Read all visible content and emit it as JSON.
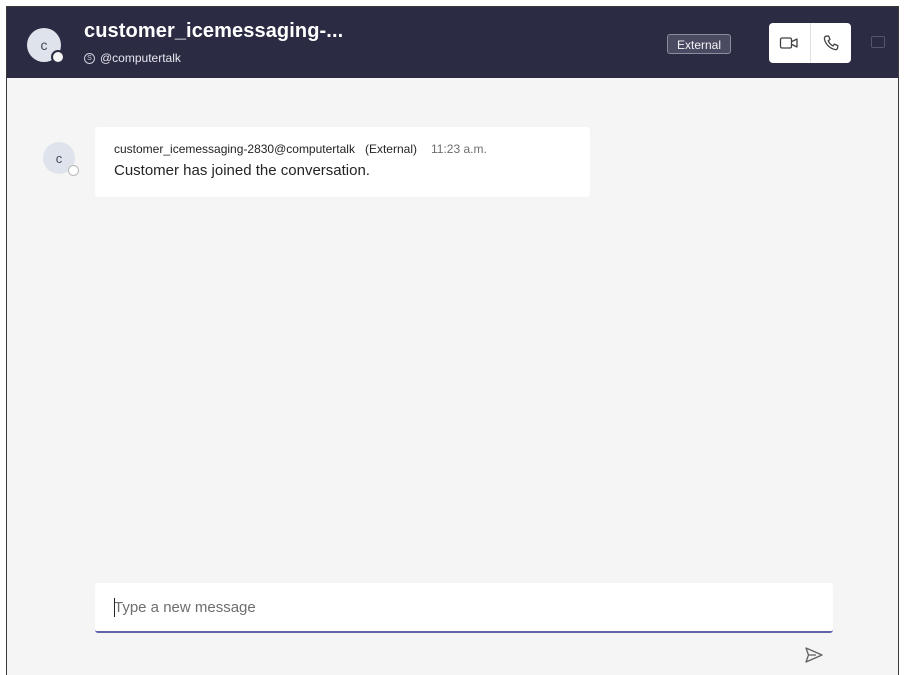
{
  "header": {
    "avatar_initial": "c",
    "title": "customer_icemessaging-...",
    "subtitle": "@computertalk",
    "external_badge": "External",
    "icons": {
      "skype": "skype-icon",
      "video_call": "video-camera-icon",
      "audio_call": "phone-icon",
      "extra": "panel-icon"
    }
  },
  "messages": [
    {
      "avatar_initial": "c",
      "sender": "customer_icemessaging-2830@computertalk",
      "tag": "(External)",
      "time": "11:23 a.m.",
      "text": "Customer has joined the conversation."
    }
  ],
  "compose": {
    "placeholder": "Type a new message",
    "value": "",
    "send_icon": "send-icon"
  },
  "colors": {
    "header_bg": "#2b2c44",
    "page_bg": "#f5f5f5",
    "accent": "#6264a7",
    "bubble_bg": "#ffffff"
  }
}
